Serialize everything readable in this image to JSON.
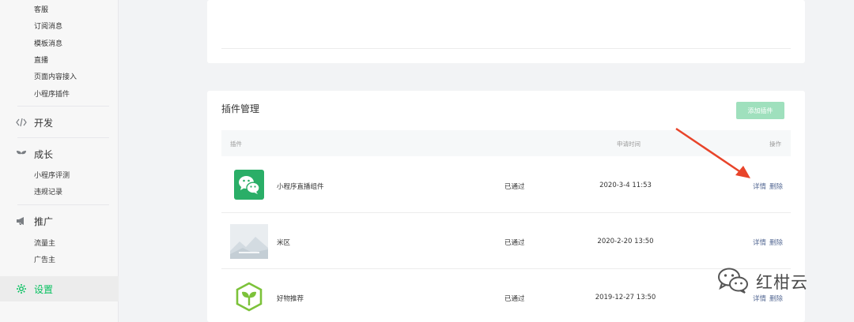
{
  "sidebar": {
    "top_items": [
      "客服",
      "订阅消息",
      "模板消息",
      "直播",
      "页面内容接入",
      "小程序插件"
    ],
    "sections": {
      "develop": {
        "label": "开发",
        "icon": "code-icon"
      },
      "growth": {
        "label": "成长",
        "icon": "sprout-icon",
        "items": [
          "小程序评测",
          "违规记录"
        ]
      },
      "promote": {
        "label": "推广",
        "icon": "megaphone-icon",
        "items": [
          "流量主",
          "广告主"
        ]
      },
      "settings": {
        "label": "设置",
        "icon": "gear-icon",
        "active": true
      }
    }
  },
  "plugins": {
    "title": "插件管理",
    "add_button": "添加插件",
    "columns": {
      "plugin": "插件",
      "apply_time": "申请时间",
      "actions": "操作"
    },
    "rows": [
      {
        "name": "小程序直播组件",
        "status": "已通过",
        "time": "2020-3-4 11:53",
        "detail": "详情",
        "delete": "删除",
        "icon": "wechat-icon"
      },
      {
        "name": "米区",
        "status": "已通过",
        "time": "2020-2-20 13:50",
        "detail": "详情",
        "delete": "删除",
        "icon": "mountain-image-icon"
      },
      {
        "name": "好物推荐",
        "status": "已通过",
        "time": "2019-12-27 13:50",
        "detail": "详情",
        "delete": "删除",
        "icon": "sprout-box-icon"
      }
    ]
  },
  "watermark": {
    "text": "红柑云",
    "icon": "wechat-outline-icon"
  },
  "colors": {
    "accent": "#07c160",
    "link": "#576b95",
    "button_disabled": "#9fe0bd",
    "arrow": "#e8442a"
  }
}
